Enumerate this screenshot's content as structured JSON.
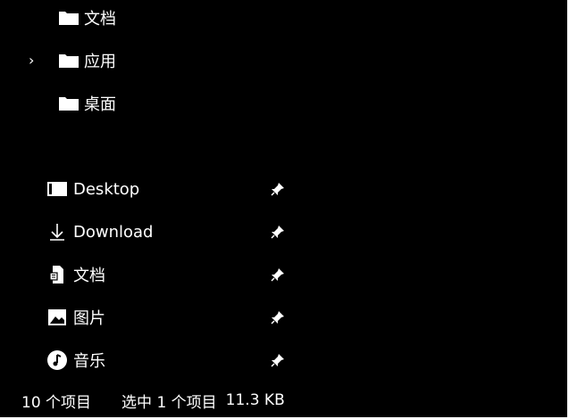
{
  "tree": {
    "items": [
      {
        "label": "文档",
        "icon": "folder-icon",
        "expandable": false
      },
      {
        "label": "应用",
        "icon": "folder-icon",
        "expandable": true
      },
      {
        "label": "桌面",
        "icon": "folder-icon",
        "expandable": false
      }
    ]
  },
  "quick_access": {
    "items": [
      {
        "label": "Desktop",
        "icon": "desktop-icon",
        "pinned": true
      },
      {
        "label": "Download",
        "icon": "download-icon",
        "pinned": true
      },
      {
        "label": "文档",
        "icon": "document-icon",
        "pinned": true
      },
      {
        "label": "图片",
        "icon": "pictures-icon",
        "pinned": true
      },
      {
        "label": "音乐",
        "icon": "music-icon",
        "pinned": true
      }
    ]
  },
  "status_bar": {
    "item_count": "10 个项目",
    "selected": "选中 1 个项目",
    "size": "11.3 KB"
  },
  "colors": {
    "background": "#000000",
    "foreground": "#ffffff"
  }
}
